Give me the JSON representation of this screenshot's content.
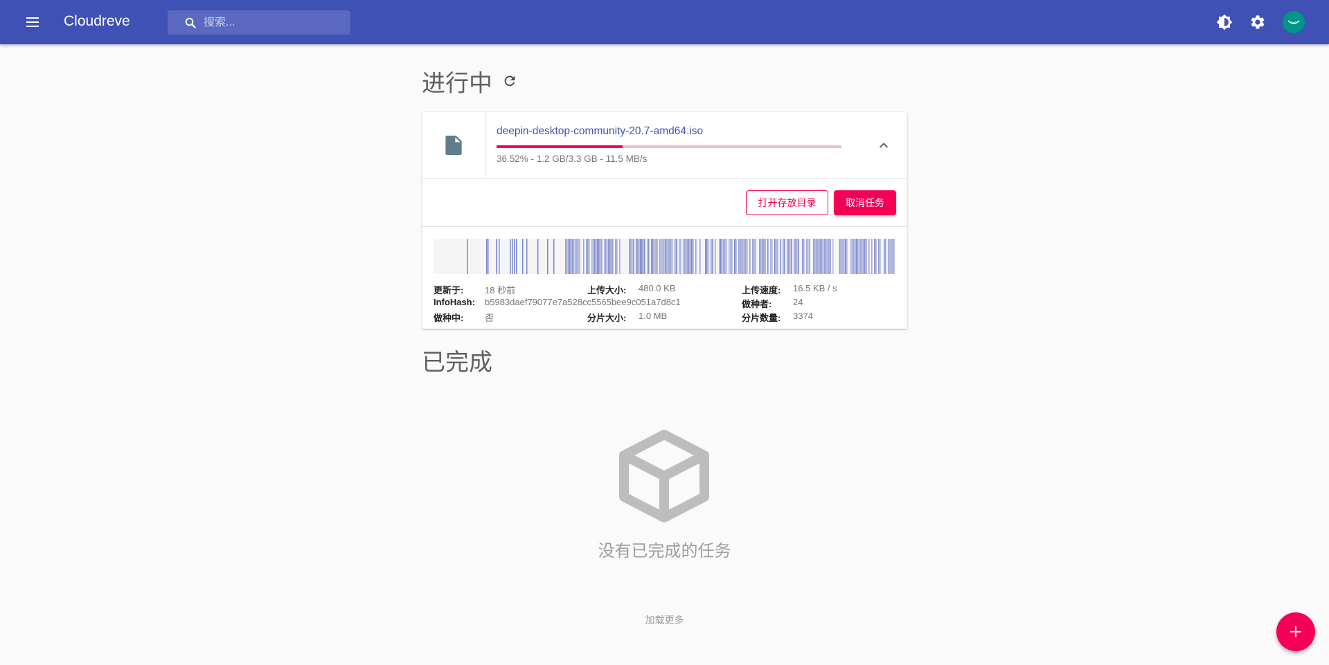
{
  "app": {
    "title": "Cloudreve"
  },
  "search": {
    "placeholder": "搜索..."
  },
  "sections": {
    "in_progress": "进行中",
    "completed": "已完成"
  },
  "task": {
    "file_name": "deepin-desktop-community-20.7-amd64.iso",
    "progress": 0.3652,
    "progress_text": "36.52% - 1.2 GB/3.3 GB - 11.5 MB/s",
    "actions": {
      "open_dir": "打开存放目录",
      "cancel": "取消任务"
    },
    "info": {
      "updated_label": "更新于:",
      "updated_value": "18 秒前",
      "upload_size_label": "上传大小:",
      "upload_size_value": "480.0 KB",
      "upload_speed_label": "上传速度:",
      "upload_speed_value": "16.5 KB / s",
      "infohash_label": "InfoHash:",
      "infohash_value": "b5983daef79077e7a528cc5565bee9c051a7d8c1",
      "seeders_label": "做种者:",
      "seeders_value": "24",
      "seeding_label": "做种中:",
      "seeding_value": "否",
      "piece_size_label": "分片大小:",
      "piece_size_value": "1.0 MB",
      "piece_count_label": "分片数量:",
      "piece_count_value": "3374"
    }
  },
  "empty": {
    "text": "没有已完成的任务"
  },
  "load_more": "加载更多",
  "colors": {
    "primary": "#3f51b5",
    "secondary": "#f50057",
    "piece": "#7986cb"
  },
  "icons": {
    "menu": "menu-icon",
    "search": "search-icon",
    "theme": "brightness-icon",
    "settings": "gear-icon",
    "refresh": "refresh-icon",
    "file": "file-icon",
    "expand": "chevron-up-icon",
    "empty": "empty-box-icon",
    "add": "add-icon"
  }
}
